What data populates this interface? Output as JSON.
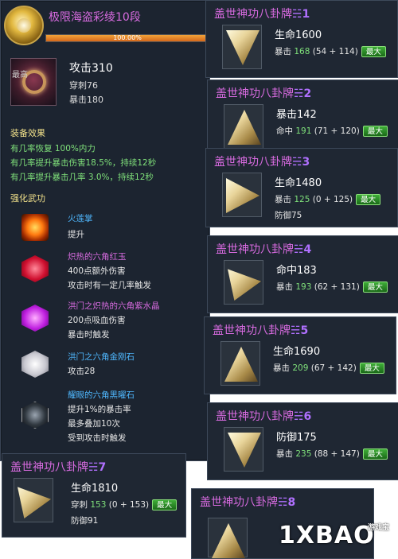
{
  "main": {
    "title": "极限海盗彩绫10段",
    "durability_text": "100.00%",
    "durability": 1.0,
    "grade": "最高",
    "attack": "攻击310",
    "pierce": "穿刺76",
    "crit": "暴击180",
    "effects_title": "装备效果",
    "effects": [
      "有几率恢复 100%内力",
      "有几率提升暴击伤害18.5%，持续12秒",
      "有几率提升暴击几率 3.0%，持续12秒"
    ],
    "enhance_title": "强化武功",
    "gems": [
      {
        "name": "火莲掌",
        "name_color": "#4fb8ff",
        "icon": "fire-skill-icon",
        "desc": [
          "提升"
        ]
      },
      {
        "name": "炽热的六角红玉",
        "name_color": "#d86be0",
        "icon": "red-gem-icon",
        "desc": [
          "400点额外伤害",
          "攻击时有一定几率触发"
        ]
      },
      {
        "name": "洪门之炽热的六角紫水晶",
        "name_color": "#d86be0",
        "icon": "purple-gem-icon",
        "desc": [
          "200点吸血伤害",
          "暴击时触发"
        ]
      },
      {
        "name": "洪门之六角金刚石",
        "name_color": "#4fb8ff",
        "icon": "diamond-gem-icon",
        "desc": [
          "攻击28"
        ]
      },
      {
        "name": "耀眼的六角黑曜石",
        "name_color": "#4fb8ff",
        "icon": "obsidian-gem-icon",
        "desc": [
          "提升1%的暴击率",
          "最多叠加10次",
          "受到攻击时触发"
        ]
      }
    ]
  },
  "cards": [
    {
      "title": "盖世神功八卦牌",
      "num": "☵1",
      "main": "生命1600",
      "sub_label": "暴击",
      "sub_value": "168",
      "sub_extra": "(54 + 114)",
      "third": "",
      "max": "最大"
    },
    {
      "title": "盖世神功八卦牌",
      "num": "☵2",
      "main": "暴击142",
      "sub_label": "命中",
      "sub_value": "191",
      "sub_extra": "(71 + 120)",
      "third": "",
      "max": "最大"
    },
    {
      "title": "盖世神功八卦牌",
      "num": "☵3",
      "main": "生命1480",
      "sub_label": "暴击",
      "sub_value": "125",
      "sub_extra": "(0 + 125)",
      "third": "防御75",
      "max": "最大"
    },
    {
      "title": "盖世神功八卦牌",
      "num": "☵4",
      "main": "命中183",
      "sub_label": "暴击",
      "sub_value": "193",
      "sub_extra": "(62 + 131)",
      "third": "",
      "max": "最大"
    },
    {
      "title": "盖世神功八卦牌",
      "num": "☵5",
      "main": "生命1690",
      "sub_label": "暴击",
      "sub_value": "209",
      "sub_extra": "(67 + 142)",
      "third": "",
      "max": "最大"
    },
    {
      "title": "盖世神功八卦牌",
      "num": "☵6",
      "main": "防御175",
      "sub_label": "暴击",
      "sub_value": "235",
      "sub_extra": "(88 + 147)",
      "third": "",
      "max": "最大"
    },
    {
      "title": "盖世神功八卦牌",
      "num": "☵7",
      "main": "生命1810",
      "sub_label": "穿刺",
      "sub_value": "153",
      "sub_extra": "(0 + 153)",
      "third": "防御91",
      "max": "最大"
    },
    {
      "title": "盖世神功八卦牌",
      "num": "☵8",
      "main": "",
      "sub_label": "",
      "sub_value": "",
      "sub_extra": "",
      "third": "",
      "max": ""
    }
  ],
  "watermark": {
    "big": "1XBAO",
    "small1": "游戏宝",
    "small2": "www.1xbao.com"
  }
}
